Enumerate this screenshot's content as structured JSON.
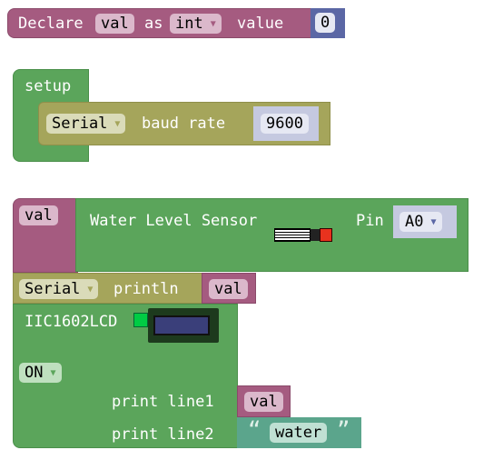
{
  "declare": {
    "label": "Declare",
    "var": "val",
    "as": "as",
    "type": "int",
    "value_label": "value",
    "value": "0"
  },
  "setup": {
    "label": "setup",
    "serial": "Serial",
    "baud_label": "baud rate",
    "baud": "9600"
  },
  "sensor": {
    "var": "val",
    "label": "Water Level Sensor",
    "pin_label": "Pin",
    "pin": "A0"
  },
  "println": {
    "serial": "Serial",
    "label": "println",
    "var": "val"
  },
  "lcd": {
    "label": "IIC1602LCD",
    "state": "ON",
    "line1_label": "print line1",
    "line1_var": "val",
    "line2_label": "print line2",
    "open_quote": "“",
    "line2_text": "water",
    "close_quote": "”"
  },
  "colors": {
    "variables": "#a55b80",
    "math": "#5b67a5",
    "control": "#5ba55b",
    "serial": "#a5a55b",
    "text": "#5ba58c"
  }
}
